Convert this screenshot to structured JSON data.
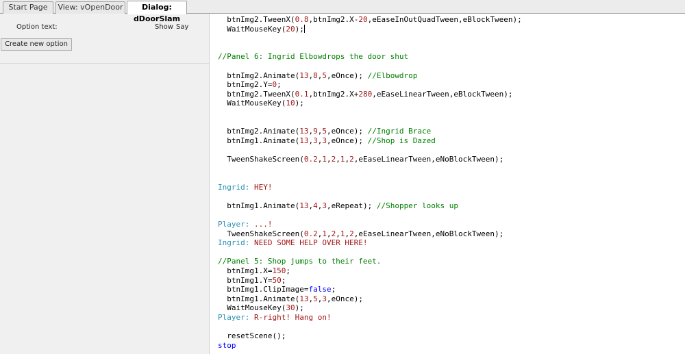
{
  "tabs": [
    "Start Page",
    "View: vOpenDoor",
    "Dialog: dDoorSlam"
  ],
  "left_panel": {
    "option_text_label": "Option text:",
    "show_label": "Show",
    "say_label": "Say",
    "create_button_label": "Create new option"
  },
  "code_lines": [
    [
      [
        "t",
        "  btnImg2.TweenX("
      ],
      [
        "n",
        "0.8"
      ],
      [
        "t",
        ",btnImg2.X-"
      ],
      [
        "n",
        "20"
      ],
      [
        "t",
        ",eEaseInOutQuadTween,eBlockTween);"
      ]
    ],
    [
      [
        "t",
        "  WaitMouseKey("
      ],
      [
        "n",
        "20"
      ],
      [
        "t",
        ");"
      ],
      [
        "caret",
        ""
      ]
    ],
    [],
    [],
    [
      [
        "c",
        "//Panel 6: Ingrid Elbowdrops the door shut"
      ]
    ],
    [],
    [
      [
        "t",
        "  btnImg2.Animate("
      ],
      [
        "n",
        "13"
      ],
      [
        "t",
        ","
      ],
      [
        "n",
        "8"
      ],
      [
        "t",
        ","
      ],
      [
        "n",
        "5"
      ],
      [
        "t",
        ",eOnce); "
      ],
      [
        "c",
        "//Elbowdrop"
      ]
    ],
    [
      [
        "t",
        "  btnImg2.Y="
      ],
      [
        "n",
        "0"
      ],
      [
        "t",
        ";"
      ]
    ],
    [
      [
        "t",
        "  btnImg2.TweenX("
      ],
      [
        "n",
        "0.1"
      ],
      [
        "t",
        ",btnImg2.X+"
      ],
      [
        "n",
        "280"
      ],
      [
        "t",
        ",eEaseLinearTween,eBlockTween);"
      ]
    ],
    [
      [
        "t",
        "  WaitMouseKey("
      ],
      [
        "n",
        "10"
      ],
      [
        "t",
        ");"
      ]
    ],
    [],
    [],
    [
      [
        "t",
        "  btnImg2.Animate("
      ],
      [
        "n",
        "13"
      ],
      [
        "t",
        ","
      ],
      [
        "n",
        "9"
      ],
      [
        "t",
        ","
      ],
      [
        "n",
        "5"
      ],
      [
        "t",
        ",eOnce); "
      ],
      [
        "c",
        "//Ingrid Brace"
      ]
    ],
    [
      [
        "t",
        "  btnImg1.Animate("
      ],
      [
        "n",
        "13"
      ],
      [
        "t",
        ","
      ],
      [
        "n",
        "3"
      ],
      [
        "t",
        ","
      ],
      [
        "n",
        "3"
      ],
      [
        "t",
        ",eOnce); "
      ],
      [
        "c",
        "//Shop is Dazed"
      ]
    ],
    [],
    [
      [
        "t",
        "  TweenShakeScreen("
      ],
      [
        "n",
        "0.2"
      ],
      [
        "t",
        ","
      ],
      [
        "n",
        "1"
      ],
      [
        "t",
        ","
      ],
      [
        "n",
        "2"
      ],
      [
        "t",
        ","
      ],
      [
        "n",
        "1"
      ],
      [
        "t",
        ","
      ],
      [
        "n",
        "2"
      ],
      [
        "t",
        ",eEaseLinearTween,eNoBlockTween);"
      ]
    ],
    [],
    [],
    [
      [
        "h",
        "Ingrid: "
      ],
      [
        "d",
        "HEY!"
      ]
    ],
    [],
    [
      [
        "t",
        "  btnImg1.Animate("
      ],
      [
        "n",
        "13"
      ],
      [
        "t",
        ","
      ],
      [
        "n",
        "4"
      ],
      [
        "t",
        ","
      ],
      [
        "n",
        "3"
      ],
      [
        "t",
        ",eRepeat); "
      ],
      [
        "c",
        "//Shopper looks up"
      ]
    ],
    [],
    [
      [
        "h",
        "Player: "
      ],
      [
        "d",
        "...!"
      ]
    ],
    [
      [
        "t",
        "  TweenShakeScreen("
      ],
      [
        "n",
        "0.2"
      ],
      [
        "t",
        ","
      ],
      [
        "n",
        "1"
      ],
      [
        "t",
        ","
      ],
      [
        "n",
        "2"
      ],
      [
        "t",
        ","
      ],
      [
        "n",
        "1"
      ],
      [
        "t",
        ","
      ],
      [
        "n",
        "2"
      ],
      [
        "t",
        ",eEaseLinearTween,eNoBlockTween);"
      ]
    ],
    [
      [
        "h",
        "Ingrid: "
      ],
      [
        "d",
        "NEED SOME HELP OVER HERE!"
      ]
    ],
    [],
    [
      [
        "c",
        "//Panel 5: Shop jumps to their feet."
      ]
    ],
    [
      [
        "t",
        "  btnImg1.X="
      ],
      [
        "n",
        "150"
      ],
      [
        "t",
        ";"
      ]
    ],
    [
      [
        "t",
        "  btnImg1.Y="
      ],
      [
        "n",
        "50"
      ],
      [
        "t",
        ";"
      ]
    ],
    [
      [
        "t",
        "  btnImg1.ClipImage="
      ],
      [
        "k",
        "false"
      ],
      [
        "t",
        ";"
      ]
    ],
    [
      [
        "t",
        "  btnImg1.Animate("
      ],
      [
        "n",
        "13"
      ],
      [
        "t",
        ","
      ],
      [
        "n",
        "5"
      ],
      [
        "t",
        ","
      ],
      [
        "n",
        "3"
      ],
      [
        "t",
        ",eOnce);"
      ]
    ],
    [
      [
        "t",
        "  WaitMouseKey("
      ],
      [
        "n",
        "30"
      ],
      [
        "t",
        ");"
      ]
    ],
    [
      [
        "h",
        "Player: "
      ],
      [
        "d",
        "R-right! Hang on!"
      ]
    ],
    [],
    [
      [
        "t",
        "  resetScene();"
      ]
    ],
    [
      [
        "k",
        "stop"
      ]
    ]
  ],
  "colors": {
    "comment": "#008000",
    "number": "#a31515",
    "keyword": "#0000ff",
    "character": "#2b91af",
    "dialog_text": "#a31515"
  }
}
